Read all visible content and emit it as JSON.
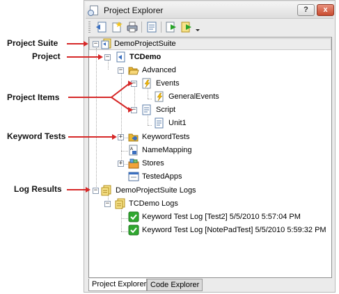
{
  "window": {
    "title": "Project Explorer",
    "help_symbol": "?",
    "close_symbol": "x"
  },
  "toolbar": {
    "buttons": [
      "go-to-editor-icon",
      "new-item-icon",
      "print-icon",
      "properties-icon",
      "run-icon",
      "run-project-icon",
      "dropdown-arrow-icon"
    ]
  },
  "tree": {
    "suite": "DemoProjectSuite",
    "project": "TCDemo",
    "advanced": "Advanced",
    "events": "Events",
    "general_events": "GeneralEvents",
    "script": "Script",
    "unit1": "Unit1",
    "keyword_tests": "KeywordTests",
    "name_mapping": "NameMapping",
    "stores": "Stores",
    "tested_apps": "TestedApps",
    "suite_logs": "DemoProjectSuite Logs",
    "project_logs": "TCDemo Logs",
    "log1": "Keyword Test Log [Test2]  5/5/2010 5:57:04 PM",
    "log2": "Keyword Test Log [NotePadTest]  5/5/2010 5:59:32 PM"
  },
  "tabs": [
    "Project Explorer",
    "Code Explorer"
  ],
  "callouts": {
    "project_suite": "Project Suite",
    "project": "Project",
    "project_items": "Project Items",
    "keyword_tests": "Keyword Tests",
    "log_results": "Log Results"
  },
  "colors": {
    "accent_red": "#d62828",
    "log_green": "#2fa82f",
    "folder_yellow": "#f2c94c"
  }
}
